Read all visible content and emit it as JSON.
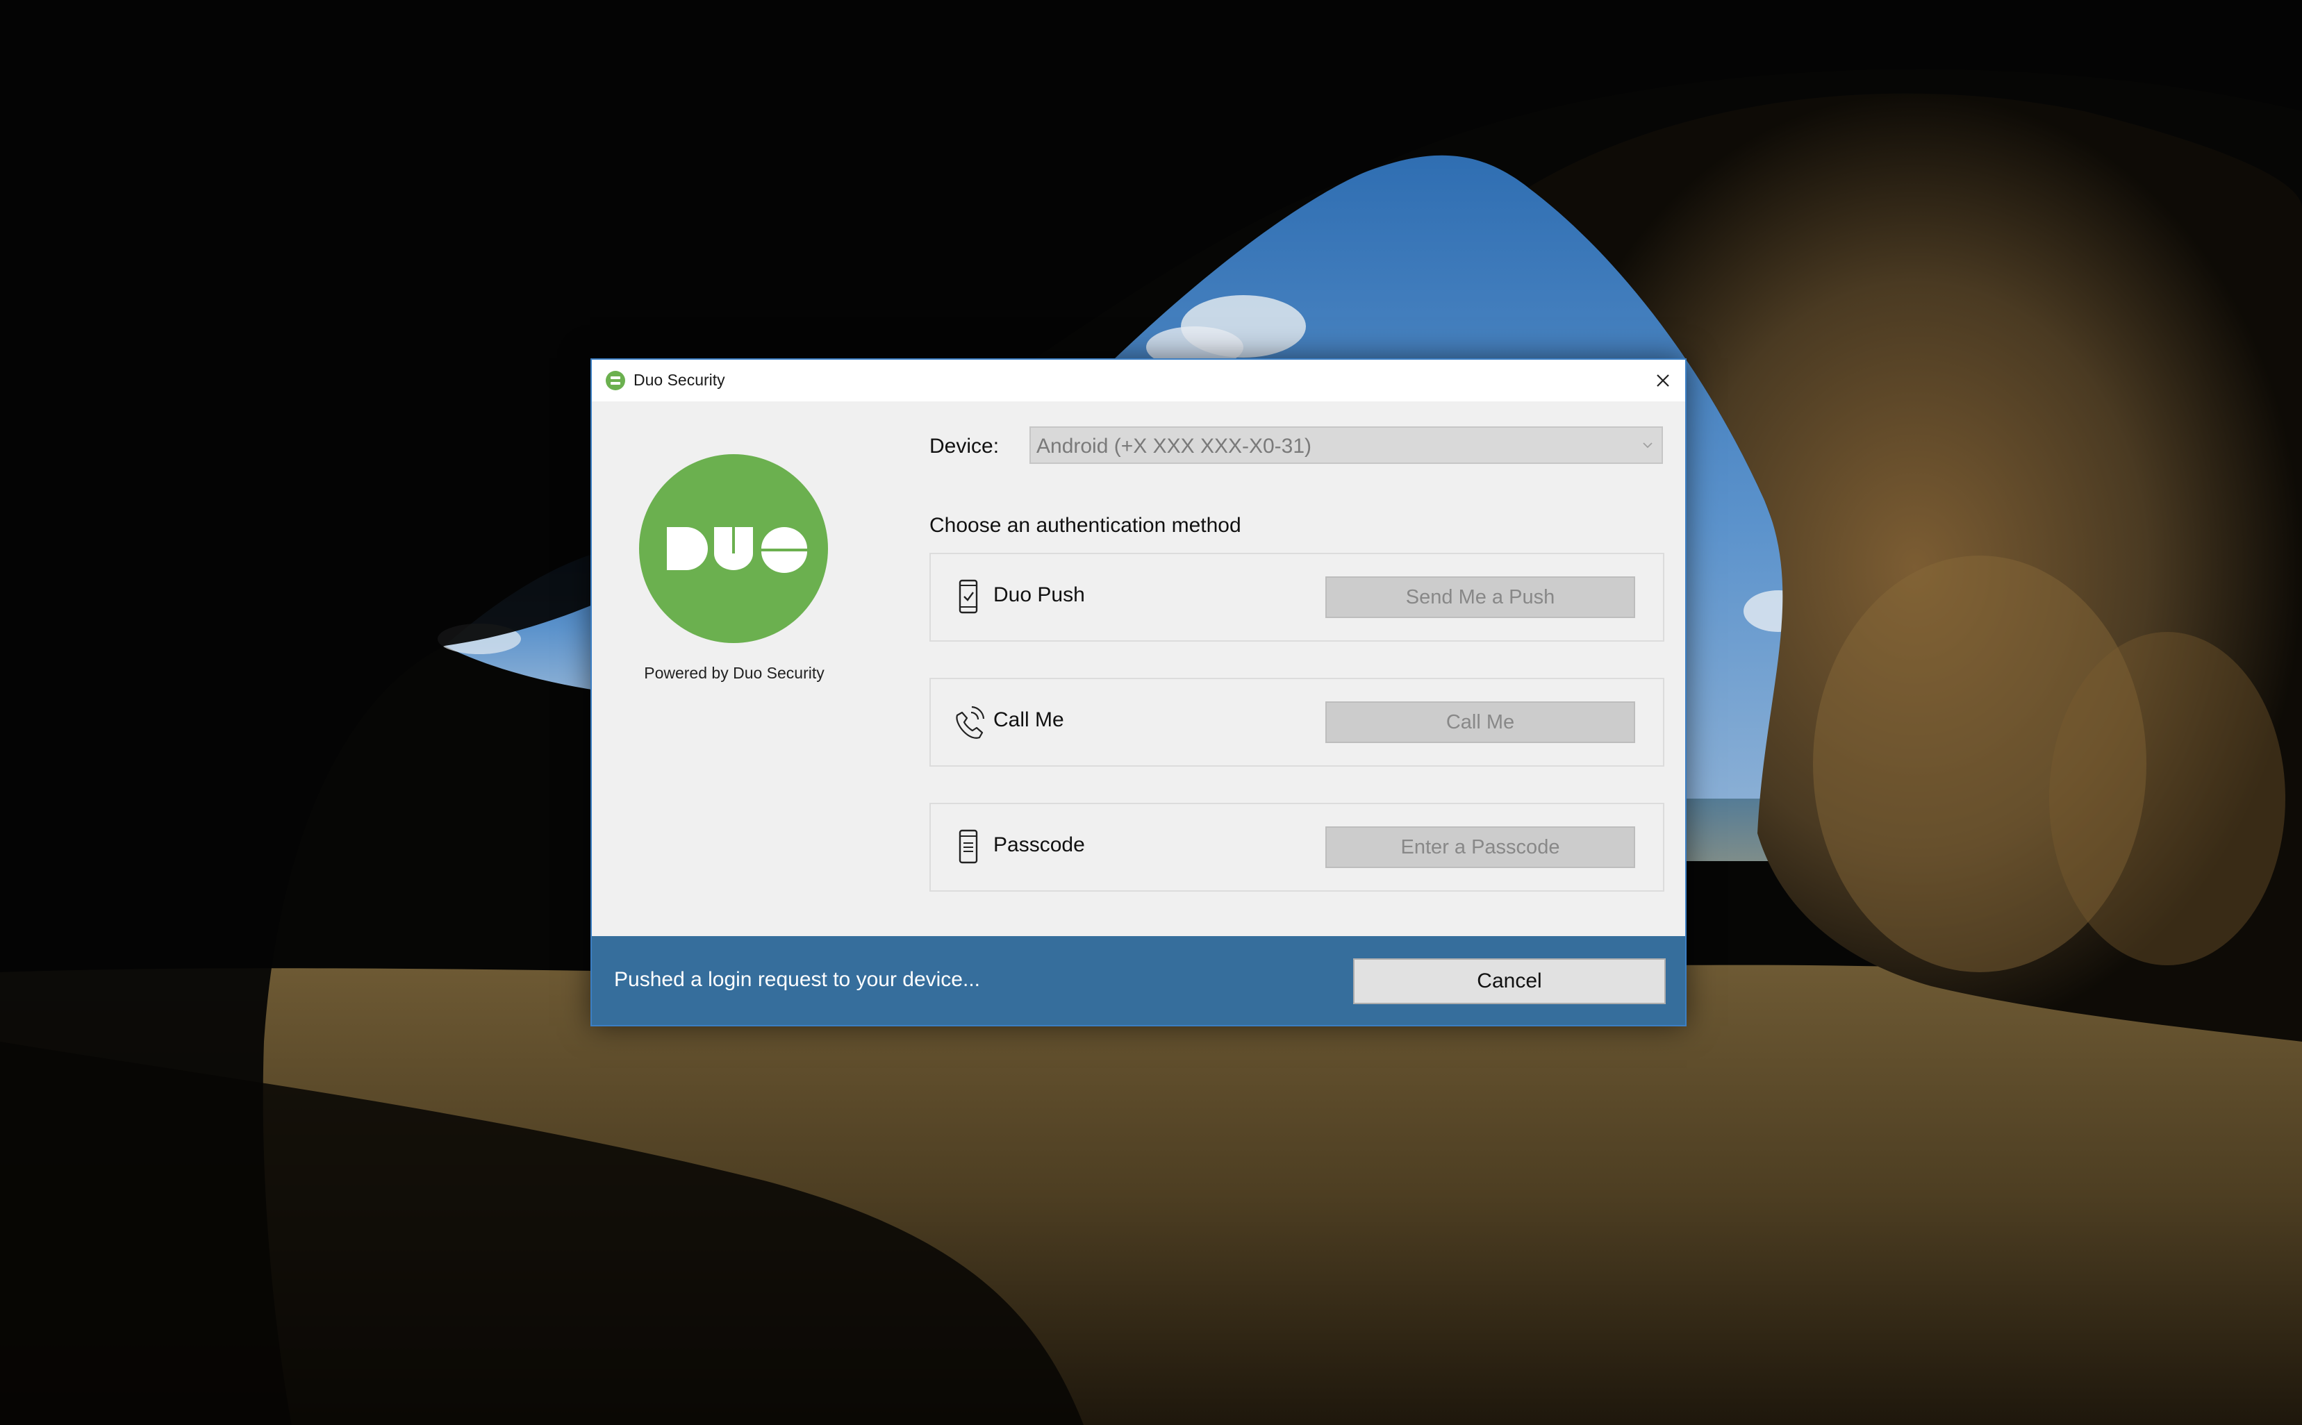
{
  "window": {
    "title": "Duo Security",
    "close_icon": "close-icon",
    "title_icon": "duo-icon"
  },
  "branding": {
    "logo_text": "DUO",
    "logo_color": "#6bb04f",
    "powered_by": "Powered by Duo Security"
  },
  "device": {
    "label": "Device:",
    "selected": "Android (+X XXX XXX-X0-31)"
  },
  "methods_heading": "Choose an authentication method",
  "methods": [
    {
      "label": "Duo Push",
      "button": "Send Me a Push",
      "icon": "phone-check-icon"
    },
    {
      "label": "Call Me",
      "button": "Call Me",
      "icon": "phone-call-icon"
    },
    {
      "label": "Passcode",
      "button": "Enter a Passcode",
      "icon": "passcode-token-icon"
    }
  ],
  "status": {
    "message": "Pushed a login request to your device...",
    "cancel_label": "Cancel",
    "bar_color": "#366e9c"
  }
}
